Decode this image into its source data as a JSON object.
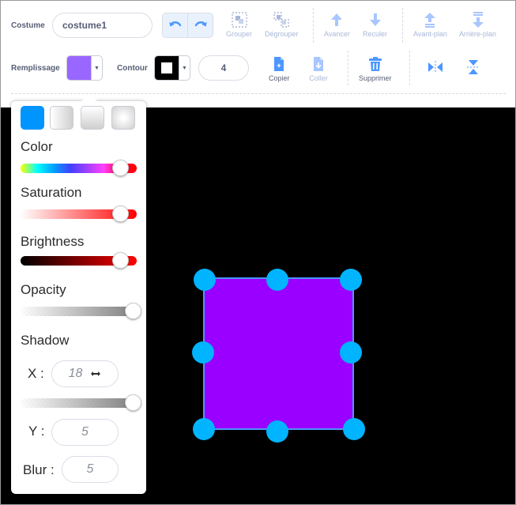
{
  "toolbar": {
    "costume_label": "Costume",
    "costume_name": "costume1",
    "fill_label": "Remplissage",
    "outline_label": "Contour",
    "outline_width": "4",
    "tools_row1": {
      "group": "Grouper",
      "ungroup": "Dégrouper",
      "forward": "Avancer",
      "backward": "Reculer",
      "front": "Avant-plan",
      "back": "Arrière-plan"
    },
    "tools_row2": {
      "copy": "Copier",
      "paste": "Coller",
      "delete": "Supprimer"
    }
  },
  "colors": {
    "fill": "#9966ff",
    "outline": "#000000",
    "accent": "#4c97ff",
    "delete": "#4c97ff",
    "shape_fill": "#9900ff",
    "handle": "#00b4ff"
  },
  "popover": {
    "color_label": "Color",
    "saturation_label": "Saturation",
    "brightness_label": "Brightness",
    "opacity_label": "Opacity",
    "shadow_label": "Shadow",
    "x_label": "X :",
    "x_value": "18",
    "y_label": "Y :",
    "y_value": "5",
    "blur_label": "Blur :",
    "blur_value": "5",
    "levels": {
      "color": 0.88,
      "saturation": 0.88,
      "brightness": 0.88,
      "opacity": 1.0,
      "shadow_x": 1.0
    }
  }
}
